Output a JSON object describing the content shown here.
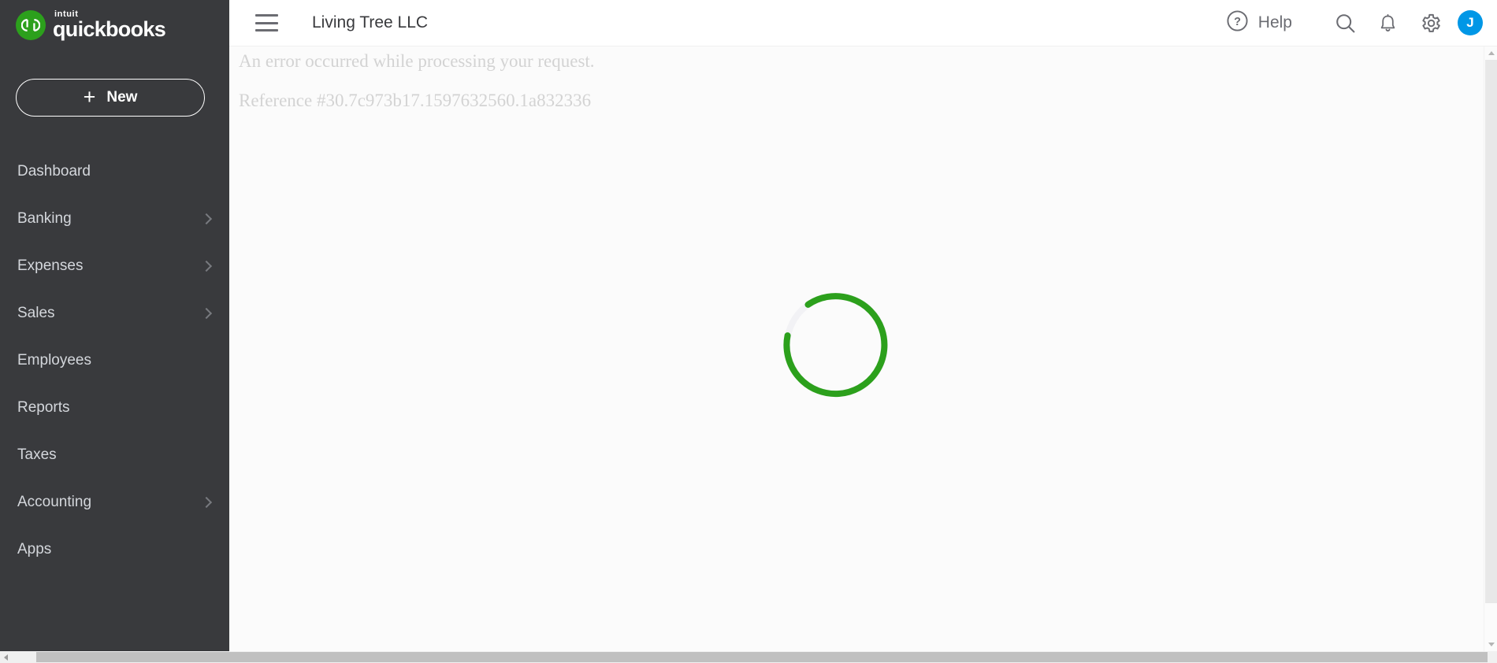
{
  "sidebar": {
    "brand": {
      "logo_icon": "quickbooks-logo-icon",
      "intuit": "intuit",
      "product": "quickbooks"
    },
    "new_button": {
      "label": "New",
      "plus_icon": "plus-icon",
      "plus": "+"
    },
    "items": [
      {
        "label": "Dashboard",
        "has_chevron": false,
        "icon": ""
      },
      {
        "label": "Banking",
        "has_chevron": true,
        "icon": "chevron-right-icon"
      },
      {
        "label": "Expenses",
        "has_chevron": true,
        "icon": "chevron-right-icon"
      },
      {
        "label": "Sales",
        "has_chevron": true,
        "icon": "chevron-right-icon"
      },
      {
        "label": "Employees",
        "has_chevron": false,
        "icon": ""
      },
      {
        "label": "Reports",
        "has_chevron": false,
        "icon": ""
      },
      {
        "label": "Taxes",
        "has_chevron": false,
        "icon": ""
      },
      {
        "label": "Accounting",
        "has_chevron": true,
        "icon": "chevron-right-icon"
      },
      {
        "label": "Apps",
        "has_chevron": false,
        "icon": ""
      }
    ]
  },
  "topbar": {
    "menu_icon": "hamburger-menu-icon",
    "company_name": "Living Tree LLC",
    "help": {
      "icon": "help-circle-icon",
      "label": "Help"
    },
    "search_icon": "search-icon",
    "notifications_icon": "bell-icon",
    "settings_icon": "gear-icon",
    "avatar": {
      "initial": "J",
      "color": "#0097e6"
    }
  },
  "main": {
    "error_message": "An error occurred while processing your request.",
    "reference": "Reference #30.7c973b17.1597632560.1a832336",
    "spinner": {
      "icon": "loading-spinner-icon",
      "color": "#2ca01c",
      "track_color": "#f2f2f5"
    }
  },
  "scrollbars": {
    "vertical_up_icon": "scroll-arrow-up-icon",
    "vertical_down_icon": "scroll-arrow-down-icon",
    "horizontal_left_icon": "scroll-arrow-left-icon"
  },
  "colors": {
    "sidebar_bg": "#393a3d",
    "brand_green": "#2ca01c",
    "content_bg": "#fbfbfb",
    "avatar_blue": "#0097e6",
    "nav_text": "#d4d7dc",
    "error_text": "#d3d3d3"
  }
}
